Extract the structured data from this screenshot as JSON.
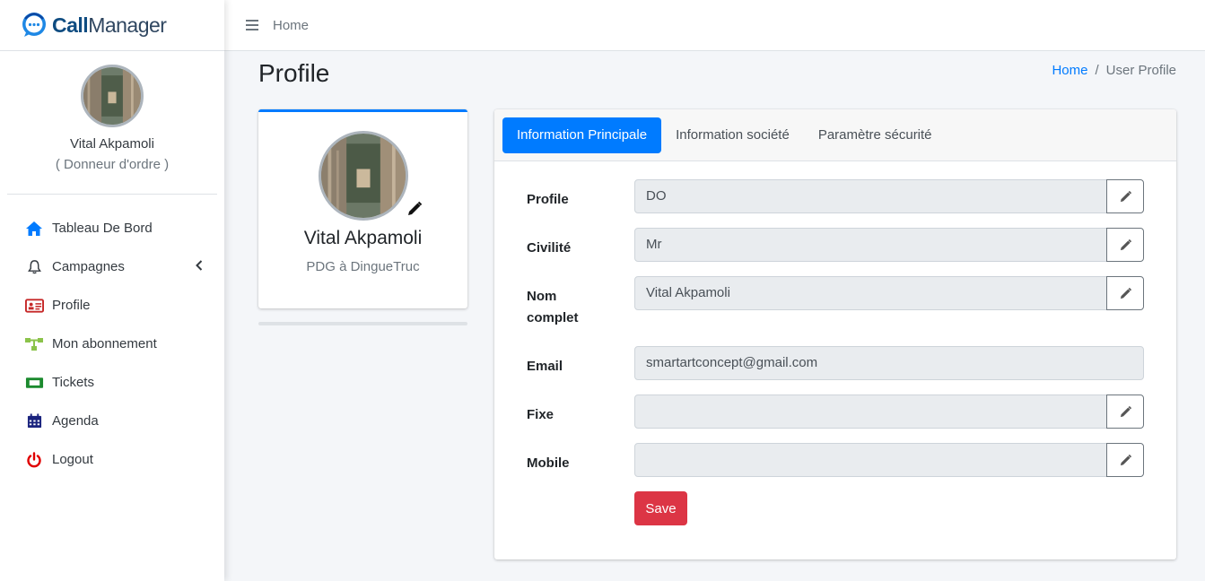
{
  "brand": {
    "name_bold": "Call",
    "name_rest": "Manager"
  },
  "user": {
    "name": "Vital Akpamoli",
    "role": "( Donneur d'ordre )",
    "job": "PDG à DingueTruc"
  },
  "sidebar": {
    "items": [
      {
        "label": "Tableau De Bord",
        "icon": "home-icon",
        "color": "#007bff"
      },
      {
        "label": "Campagnes",
        "icon": "bell-icon",
        "color": "#343a40"
      },
      {
        "label": "Profile",
        "icon": "id-card-icon",
        "color": "#dc3545"
      },
      {
        "label": "Mon abonnement",
        "icon": "sitemap-icon",
        "color": "#8bc34a"
      },
      {
        "label": "Tickets",
        "icon": "ticket-icon",
        "color": "#28a745"
      },
      {
        "label": "Agenda",
        "icon": "calendar-icon",
        "color": "#1a237e"
      },
      {
        "label": "Logout",
        "icon": "power-icon",
        "color": "#dc3545"
      }
    ]
  },
  "topbar": {
    "home": "Home"
  },
  "page": {
    "title": "Profile"
  },
  "breadcrumb": {
    "home": "Home",
    "sep": "/",
    "current": "User Profile"
  },
  "tabs": [
    {
      "label": "Information Principale",
      "active": true
    },
    {
      "label": "Information société",
      "active": false
    },
    {
      "label": "Paramètre sécurité",
      "active": false
    }
  ],
  "form": {
    "fields": [
      {
        "label": "Profile",
        "value": "DO",
        "editable": true
      },
      {
        "label": "Civilité",
        "value": "Mr",
        "editable": true
      },
      {
        "label": "Nom complet",
        "value": "Vital Akpamoli",
        "editable": true
      },
      {
        "label": "Email",
        "value": "smartartconcept@gmail.com",
        "editable": false
      },
      {
        "label": "Fixe",
        "value": "",
        "editable": true
      },
      {
        "label": "Mobile",
        "value": "",
        "editable": true
      }
    ],
    "save_label": "Save"
  },
  "colors": {
    "primary": "#007bff",
    "danger": "#dc3545"
  }
}
